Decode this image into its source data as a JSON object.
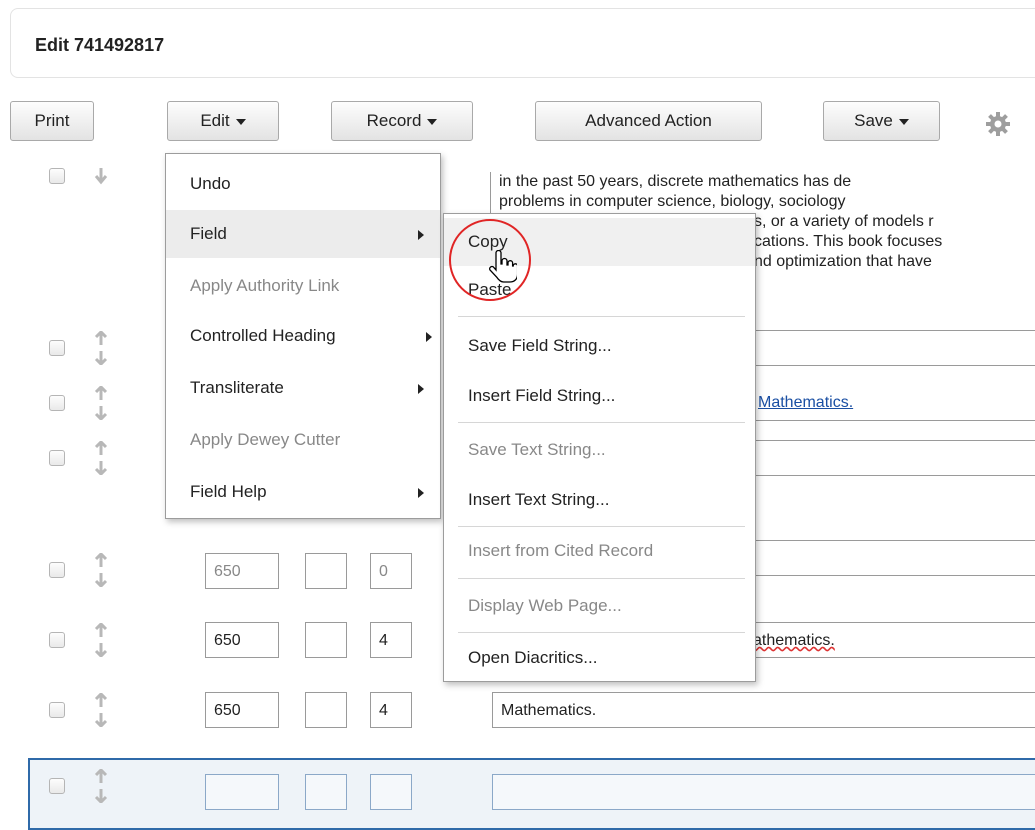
{
  "header": {
    "title": "Edit 741492817"
  },
  "toolbar": {
    "print_label": "Print",
    "edit_label": "Edit",
    "record_label": "Record",
    "advanced_label": "Advanced Action",
    "save_label": "Save"
  },
  "description_lines": [
    "in the past 50 years, discrete mathematics has de",
    "problems in computer science, biology, sociology",
    "s, or a variety of models r",
    "cations. This book focuses",
    "nd optimization that have"
  ],
  "rows": [
    {
      "tag": "",
      "ind1": "",
      "ind2": "",
      "value": ""
    },
    {
      "tag": "",
      "ind1": "",
      "ind2": "",
      "value": "Mathematics."
    },
    {
      "tag": "",
      "ind1": "",
      "ind2": "",
      "value": ""
    },
    {
      "tag": "650",
      "ind1": "",
      "ind2": "0",
      "value": ""
    },
    {
      "tag": "650",
      "ind1": "",
      "ind2": "4",
      "value": "athematics."
    },
    {
      "tag": "650",
      "ind1": "",
      "ind2": "4",
      "value": "Mathematics."
    },
    {
      "tag": "",
      "ind1": "",
      "ind2": "",
      "value": ""
    }
  ],
  "edit_menu": [
    {
      "label": "Undo",
      "disabled": false,
      "submenu": false
    },
    {
      "label": "Field",
      "disabled": false,
      "submenu": true
    },
    {
      "label": "Apply Authority Link",
      "disabled": true,
      "submenu": false
    },
    {
      "label": "Controlled Heading",
      "disabled": false,
      "submenu": true
    },
    {
      "label": "Transliterate",
      "disabled": false,
      "submenu": true
    },
    {
      "label": "Apply Dewey Cutter",
      "disabled": true,
      "submenu": false
    },
    {
      "label": "Field Help",
      "disabled": false,
      "submenu": true
    }
  ],
  "field_menu": [
    {
      "label": "Copy",
      "disabled": false
    },
    {
      "label": "Paste",
      "disabled": false
    },
    {
      "label": "Save Field String...",
      "disabled": false
    },
    {
      "label": "Insert Field String...",
      "disabled": false
    },
    {
      "label": "Save Text String...",
      "disabled": true
    },
    {
      "label": "Insert Text String...",
      "disabled": false
    },
    {
      "label": "Insert from Cited Record",
      "disabled": true
    },
    {
      "label": "Display Web Page...",
      "disabled": true
    },
    {
      "label": "Open Diacritics...",
      "disabled": false
    }
  ],
  "icons": {
    "settings": "gear-icon",
    "cursor": "hand-pointer-icon"
  },
  "colors": {
    "highlight": "#e02525",
    "link": "#1a4fa3",
    "selected_row_border": "#2f6aa9"
  }
}
